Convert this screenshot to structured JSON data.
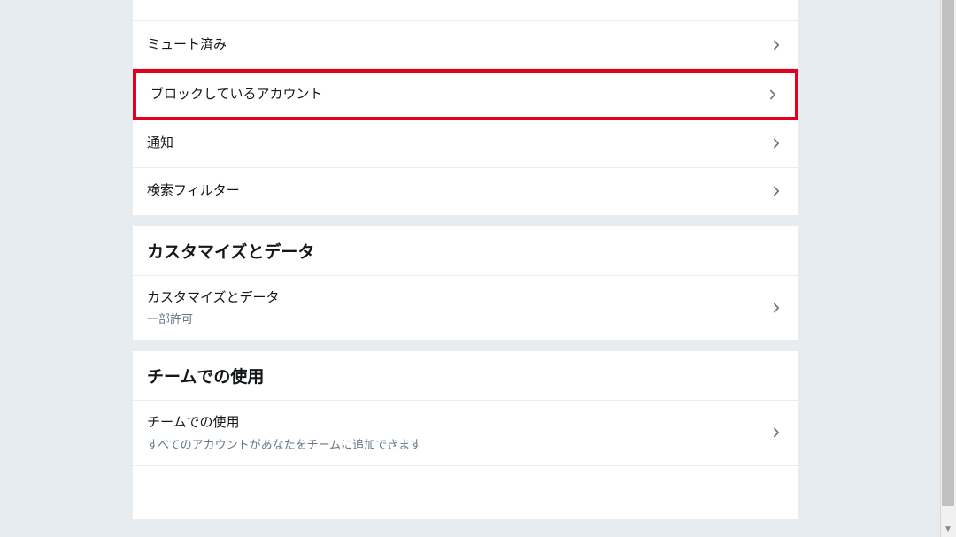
{
  "settings": {
    "items": [
      {
        "label": "ミュート済み"
      },
      {
        "label": "ブロックしているアカウント",
        "highlighted": true
      },
      {
        "label": "通知"
      },
      {
        "label": "検索フィルター"
      }
    ]
  },
  "sections": [
    {
      "header": "カスタマイズとデータ",
      "items": [
        {
          "label": "カスタマイズとデータ",
          "subtitle": "一部許可"
        }
      ]
    },
    {
      "header": "チームでの使用",
      "items": [
        {
          "label": "チームでの使用",
          "subtitle": "すべてのアカウントがあなたをチームに追加できます"
        }
      ]
    }
  ]
}
